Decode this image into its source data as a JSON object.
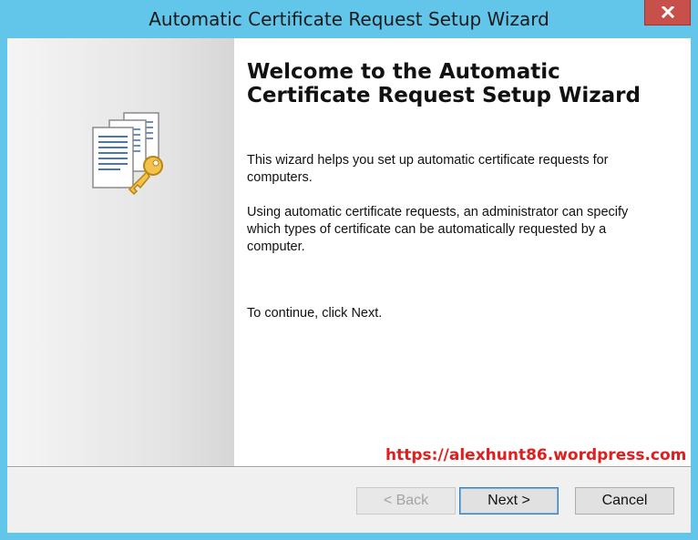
{
  "window": {
    "title": "Automatic Certificate Request Setup Wizard",
    "close_icon": "close-icon"
  },
  "left_panel": {
    "icon": "certificate-documents-key-icon"
  },
  "content": {
    "heading": "Welcome to the Automatic Certificate Request Setup Wizard",
    "paragraph1": "This wizard helps you set up automatic certificate requests for computers.",
    "paragraph2": "Using automatic certificate requests, an administrator can specify which types of certificate can be automatically requested by a computer.",
    "paragraph3": "To continue, click Next."
  },
  "watermark": "https://alexhunt86.wordpress.com",
  "buttons": {
    "back": "< Back",
    "next": "Next >",
    "cancel": "Cancel"
  },
  "colors": {
    "frame": "#62c6ea",
    "close": "#c7504a",
    "watermark": "#e01e1e"
  }
}
